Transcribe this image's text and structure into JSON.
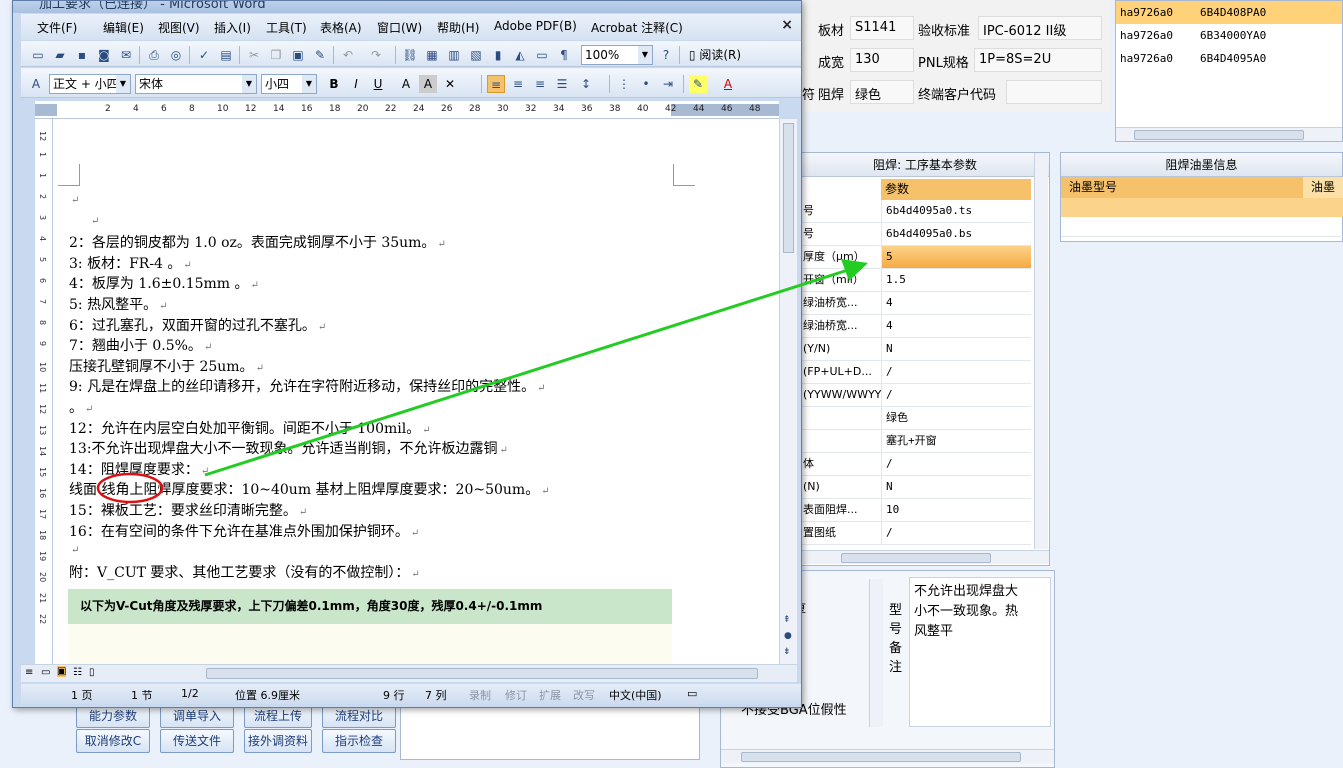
{
  "word": {
    "title": "加工要求（已连接） - Microsoft Word",
    "close": "×",
    "menu": [
      "文件(F)",
      "编辑(E)",
      "视图(V)",
      "插入(I)",
      "工具(T)",
      "表格(A)",
      "窗口(W)",
      "帮助(H)",
      "Adobe PDF(B)",
      "Acrobat 注释(C)"
    ],
    "zoom": "100%",
    "read_label": "阅读(R)",
    "style": "正文 + 小四",
    "font": "宋体",
    "size": "小四",
    "ruler_numbers": [
      "2",
      "4",
      "6",
      "8",
      "10",
      "12",
      "14",
      "16",
      "18",
      "20",
      "22",
      "24",
      "26",
      "28",
      "30",
      "32",
      "34",
      "36",
      "38",
      "40",
      "42",
      "44",
      "46",
      "48"
    ],
    "vruler_numbers": [
      "12",
      "1",
      "1",
      "2",
      "3",
      "4",
      "5",
      "6",
      "7",
      "8",
      "9",
      "10",
      "11",
      "12",
      "13",
      "14",
      "15",
      "16",
      "17",
      "18",
      "19",
      "20",
      "21",
      "22"
    ],
    "lines": [
      "",
      "",
      "2：各层的铜皮都为  1.0 oz。表面完成铜厚不小于 35um。",
      "3: 板材：FR-4  。",
      "4：板厚为  1.6±0.15mm  。",
      "5: 热风整平。",
      "6：过孔塞孔，双面开窗的过孔不塞孔。",
      "7：翘曲小于 0.5%。",
      "    压接孔壁铜厚不小于 25um。",
      "9: 凡是在焊盘上的丝印请移开，允许在字符附近移动，保持丝印的完整性。",
      "。",
      "12：允许在内层空白处加平衡铜。间距不小于 100mil。",
      "13:不允许出现焊盘大小不一致现象。允许适当削铜，不允许板边露铜",
      "14：阻焊厚度要求：",
      "线面 线角上阻焊厚度要求：10~40um 基材上阻焊厚度要求：20~50um。",
      "15：裸板工艺：要求丝印清晰完整。",
      "16：在有空间的条件下允许在基准点外围加保护铜环。",
      "",
      "附：V_CUT 要求、其他工艺要求（没有的不做控制）："
    ],
    "vcut_note": "以下为V-Cut角度及残厚要求，上下刀偏差0.1mm，角度30度，残厚0.4+/-0.1mm",
    "status": {
      "page": "1 页",
      "section": "1 节",
      "pages": "1/2",
      "position": "位置 6.9厘米",
      "line": "9 行",
      "col": "7 列",
      "rec": "录制",
      "trk": "修订",
      "ext": "扩展",
      "ovr": "改写",
      "lang": "中文(中国)"
    }
  },
  "header_fields": {
    "board_label": "板材",
    "board_value": "S1141",
    "accept_label": "验收标准",
    "accept_value": "IPC-6012 II级",
    "width_label": "成宽",
    "width_value": "130",
    "pnl_label": "PNL规格",
    "pnl_value": "1P=8S=2U",
    "mask_label": "阻焊",
    "mask_value": "绿色",
    "customer_label": "终端客户代码",
    "customer_value": "",
    "left_fragment": "符"
  },
  "top_list": [
    [
      "ha9726a0",
      "6B4D408PA0"
    ],
    [
      "ha9726a0",
      "6B34000YA0"
    ],
    [
      "ha9726a0",
      "6B4D4095A0"
    ]
  ],
  "params_panel": {
    "title": "阻焊: 工序基本参数",
    "column": "参数",
    "rows": [
      [
        "号",
        "6b4d4095a0.ts"
      ],
      [
        "号",
        "6b4d4095a0.bs"
      ],
      [
        "厚度（μm）",
        "5"
      ],
      [
        "开窗（mil）",
        "1.5"
      ],
      [
        "绿油桥宽...",
        "4"
      ],
      [
        "绿油桥宽...",
        "4"
      ],
      [
        "(Y/N)",
        "N"
      ],
      [
        "(FP+UL+D...",
        "/"
      ],
      [
        "(YYWW/WWYY)",
        "/"
      ],
      [
        "",
        "绿色"
      ],
      [
        "",
        "塞孔+开窗"
      ],
      [
        "体",
        "/"
      ],
      [
        "(N)",
        "N"
      ],
      [
        "表面阻焊...",
        "10"
      ],
      [
        "置图纸",
        "/"
      ]
    ]
  },
  "ink_panel": {
    "title": "阻焊油墨信息",
    "col1": "油墨型号",
    "col2": "油墨名"
  },
  "requirement_panel": {
    "left_text": "要求：\n角上阻焊厚\n\nn基材上\n要求：\nn。顾客\n不接受BGA位假性",
    "side_labels": "型\n号\n备\n注",
    "right_text": "不允许出现焊盘大\n小不一致现象。热\n风整平"
  },
  "bottom_buttons": {
    "b1": "能力参数",
    "b2": "调单导入",
    "b3": "流程上传",
    "b4": "流程对比",
    "b5": "取消修改C",
    "b6": "传送文件",
    "b7": "接外调资料",
    "b8": "指示检查"
  },
  "colors": {
    "highlight": "#f6a942",
    "annotation_arrow": "#22cc22",
    "annotation_circle": "#d11"
  }
}
